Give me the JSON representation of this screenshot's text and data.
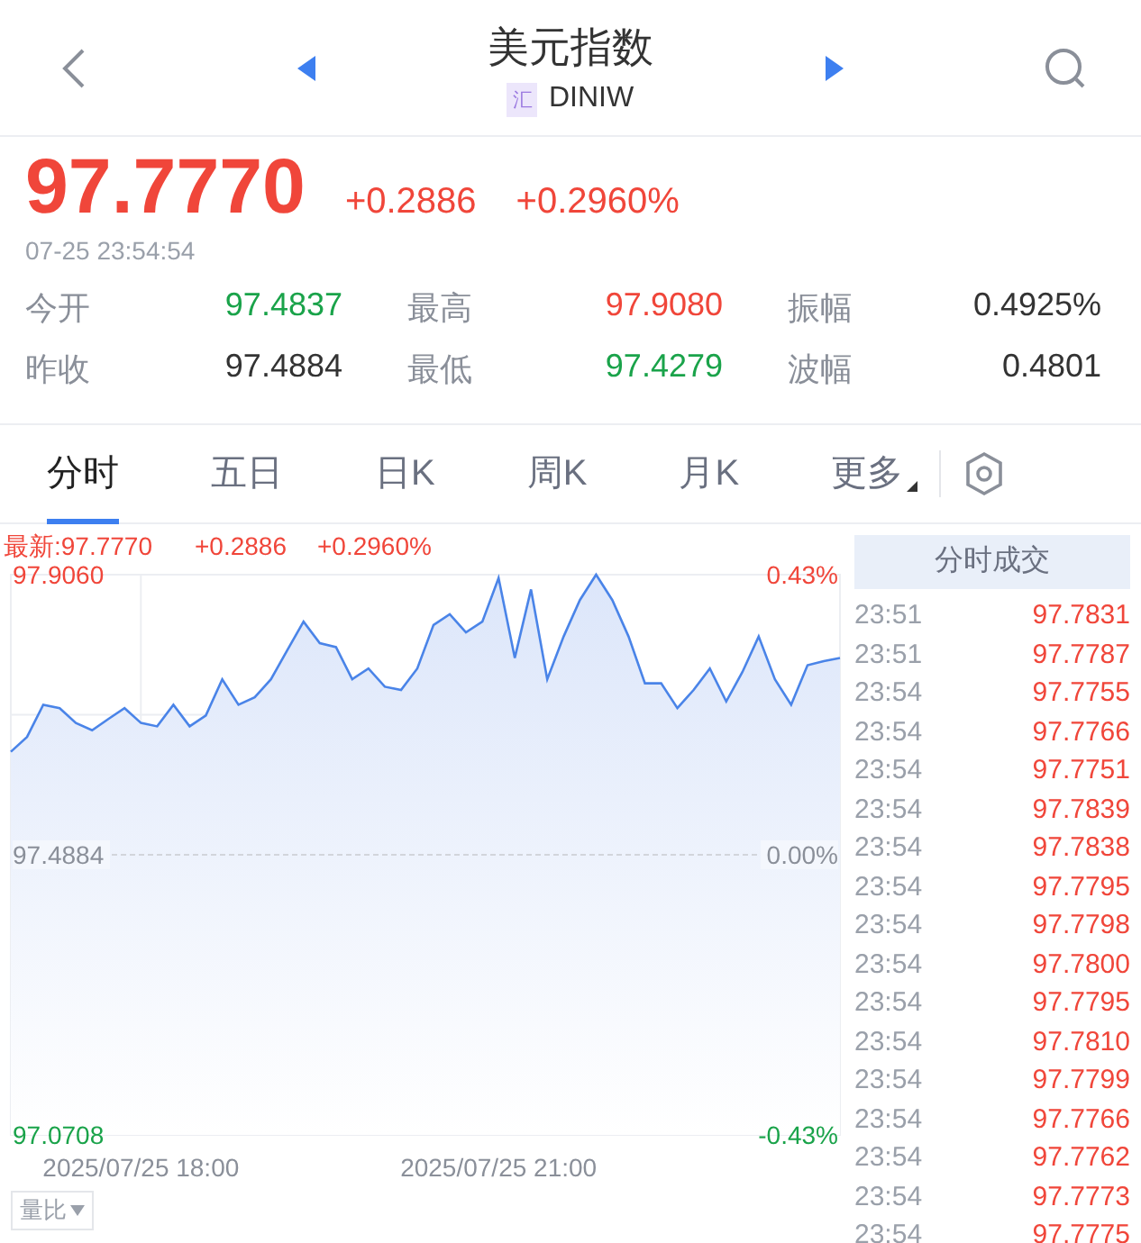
{
  "header": {
    "title": "美元指数",
    "badge": "汇",
    "code": "DINIW"
  },
  "quote": {
    "price": "97.7770",
    "change": "+0.2886",
    "change_pct": "+0.2960%",
    "time": "07-25 23:54:54"
  },
  "stats": [
    {
      "label": "今开",
      "value": "97.4837",
      "color": "#1aa34a"
    },
    {
      "label": "最高",
      "value": "97.9080",
      "color": "#f0463a"
    },
    {
      "label": "振幅",
      "value": "0.4925%",
      "color": "#333333"
    },
    {
      "label": "昨收",
      "value": "97.4884",
      "color": "#333333"
    },
    {
      "label": "最低",
      "value": "97.4279",
      "color": "#1aa34a"
    },
    {
      "label": "波幅",
      "value": "0.4801",
      "color": "#333333"
    }
  ],
  "tabs": [
    {
      "label": "分时",
      "selected": true,
      "kind": "tab"
    },
    {
      "label": "五日",
      "selected": false,
      "kind": "tab"
    },
    {
      "label": "日K",
      "selected": false,
      "kind": "tab"
    },
    {
      "label": "周K",
      "selected": false,
      "kind": "tab"
    },
    {
      "label": "月K",
      "selected": false,
      "kind": "tab"
    },
    {
      "label": "更多",
      "selected": false,
      "kind": "dropdown"
    }
  ],
  "chart": {
    "latest_label": "最新:97.7770",
    "latest_change": "+0.2886",
    "latest_pct": "+0.2960%",
    "percent_labels": [
      "0.43%",
      "0.00%",
      "-0.43%"
    ],
    "chart_data": {
      "type": "area",
      "ylim": [
        97.0708,
        97.906
      ],
      "yticks": [
        {
          "value": 97.906,
          "label": "97.9060"
        },
        {
          "value": 97.4884,
          "label": "97.4884"
        },
        {
          "value": 97.0708,
          "label": "97.0708"
        }
      ],
      "categories": [
        null,
        null,
        null,
        null,
        null,
        null,
        null,
        null,
        "2025/07/25 18:00",
        null,
        null,
        null,
        null,
        null,
        null,
        null,
        null,
        null,
        null,
        null,
        null,
        null,
        null,
        null,
        null,
        null,
        null,
        null,
        null,
        null,
        "2025/07/25 21:00",
        null,
        null,
        null,
        null,
        null,
        null,
        null,
        null,
        null,
        null,
        null,
        null,
        null,
        null,
        null,
        null,
        null,
        null,
        null,
        null,
        null
      ],
      "series": [
        {
          "color": "#4a84e8",
          "values": [
            97.642,
            97.664,
            97.712,
            97.707,
            97.685,
            97.674,
            97.691,
            97.707,
            97.685,
            97.68,
            97.712,
            97.68,
            97.696,
            97.75,
            97.712,
            97.723,
            97.75,
            97.793,
            97.836,
            97.804,
            97.798,
            97.75,
            97.766,
            97.739,
            97.734,
            97.766,
            97.831,
            97.847,
            97.82,
            97.836,
            97.901,
            97.782,
            97.884,
            97.75,
            97.814,
            97.868,
            97.906,
            97.868,
            97.814,
            97.744,
            97.744,
            97.707,
            97.734,
            97.766,
            97.717,
            97.761,
            97.814,
            97.75,
            97.712,
            97.771,
            97.777,
            97.782
          ]
        }
      ]
    }
  },
  "indicator_button": "量比",
  "trades": {
    "title": "分时成交",
    "rows": [
      {
        "time": "23:51",
        "price": "97.7831"
      },
      {
        "time": "23:51",
        "price": "97.7787"
      },
      {
        "time": "23:54",
        "price": "97.7755"
      },
      {
        "time": "23:54",
        "price": "97.7766"
      },
      {
        "time": "23:54",
        "price": "97.7751"
      },
      {
        "time": "23:54",
        "price": "97.7839"
      },
      {
        "time": "23:54",
        "price": "97.7838"
      },
      {
        "time": "23:54",
        "price": "97.7795"
      },
      {
        "time": "23:54",
        "price": "97.7798"
      },
      {
        "time": "23:54",
        "price": "97.7800"
      },
      {
        "time": "23:54",
        "price": "97.7795"
      },
      {
        "time": "23:54",
        "price": "97.7810"
      },
      {
        "time": "23:54",
        "price": "97.7799"
      },
      {
        "time": "23:54",
        "price": "97.7766"
      },
      {
        "time": "23:54",
        "price": "97.7762"
      },
      {
        "time": "23:54",
        "price": "97.7773"
      },
      {
        "time": "23:54",
        "price": "97.7775"
      }
    ]
  }
}
